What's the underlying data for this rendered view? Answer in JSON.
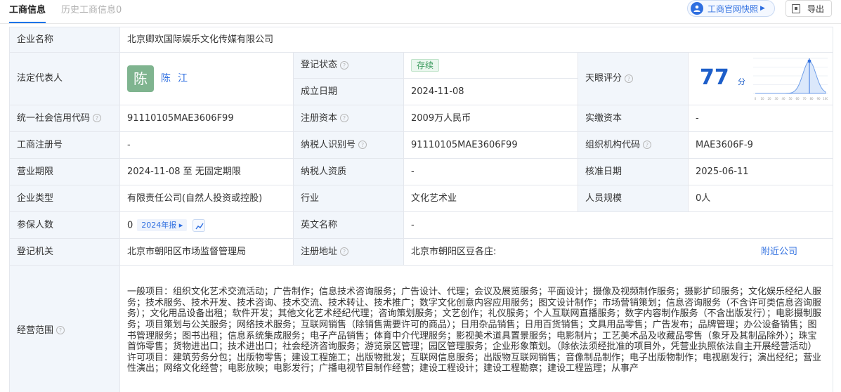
{
  "tabs": {
    "active": "工商信息",
    "history": "历史工商信息0"
  },
  "actions": {
    "snapshot_label": "工商官网快照",
    "export_label": "导出"
  },
  "info": {
    "company_name_label": "企业名称",
    "company_name": "北京卿欢国际娱乐文化传媒有限公司",
    "legal_rep_label": "法定代表人",
    "legal_rep_avatar": "陈",
    "legal_rep_name": "陈江",
    "reg_status_label": "登记状态",
    "reg_status": "存续",
    "founded_label": "成立日期",
    "founded": "2024-11-08",
    "rating_label": "天眼评分",
    "rating_score": "77",
    "rating_unit": "分",
    "credit_code_label": "统一社会信用代码",
    "credit_code": "91110105MAE3606F99",
    "reg_capital_label": "注册资本",
    "reg_capital": "2009万人民币",
    "paid_capital_label": "实缴资本",
    "paid_capital": "-",
    "biz_reg_no_label": "工商注册号",
    "biz_reg_no": "-",
    "taxpayer_id_label": "纳税人识别号",
    "taxpayer_id": "91110105MAE3606F99",
    "org_code_label": "组织机构代码",
    "org_code": "MAE3606F-9",
    "term_label": "营业期限",
    "term": "2024-11-08 至 无固定期限",
    "taxpayer_qual_label": "纳税人资质",
    "taxpayer_qual": "-",
    "approval_date_label": "核准日期",
    "approval_date": "2025-06-11",
    "company_type_label": "企业类型",
    "company_type": "有限责任公司(自然人投资或控股)",
    "industry_label": "行业",
    "industry": "文化艺术业",
    "staff_size_label": "人员规模",
    "staff_size": "0人",
    "insured_label": "参保人数",
    "insured": "0",
    "insured_year_tag": "2024年报",
    "english_name_label": "英文名称",
    "english_name": "-",
    "authority_label": "登记机关",
    "authority": "北京市朝阳区市场监督管理局",
    "address_label": "注册地址",
    "address": "北京市朝阳区豆各庄:",
    "nearby_label": "附近公司",
    "scope_label": "经营范围",
    "scope": "一般项目：组织文化艺术交流活动；广告制作；信息技术咨询服务；广告设计、代理；会议及展览服务；平面设计；摄像及视频制作服务；摄影扩印服务；文化娱乐经纪人服务；技术服务、技术开发、技术咨询、技术交流、技术转让、技术推广；数字文化创意内容应用服务；图文设计制作；市场营销策划；信息咨询服务（不含许可类信息咨询服务）；文化用品设备出租；软件开发；其他文化艺术经纪代理；咨询策划服务；文艺创作；礼仪服务；个人互联网直播服务；数字内容制作服务（不含出版发行）；电影摄制服务；项目策划与公关服务；网络技术服务；互联网销售（除销售需要许可的商品）；日用杂品销售；日用百货销售；文具用品零售；广告发布；品牌管理；办公设备销售；图书管理服务；图书出租；信息系统集成服务；电子产品销售；体育中介代理服务；影视美术道具置景服务；电影制片；工艺美术品及收藏品零售（象牙及其制品除外）；珠宝首饰零售；货物进出口；技术进出口；社会经济咨询服务；游览景区管理；园区管理服务；企业形象策划。（除依法须经批准的项目外，凭营业执照依法自主开展经营活动）许可项目：建筑劳务分包；出版物零售；建设工程施工；出版物批发；互联网信息服务；出版物互联网销售；音像制品制作；电子出版物制作；电视剧发行；演出经纪；营业性演出；网络文化经营；电影放映；电影发行；广播电视节目制作经营；建设工程设计；建设工程勘察；建设工程监理；从事产"
  },
  "rating_chart": {
    "type": "area",
    "ticks": [
      "0",
      "10",
      "20",
      "30",
      "40",
      "50",
      "60",
      "70",
      "80",
      "90",
      "100"
    ],
    "marker_value": 77
  },
  "colors": {
    "accent": "#2f6fe0",
    "label_bg": "#f2f6fb",
    "status_green": "#3a9a5c",
    "avatar_green": "#7fb48f"
  }
}
